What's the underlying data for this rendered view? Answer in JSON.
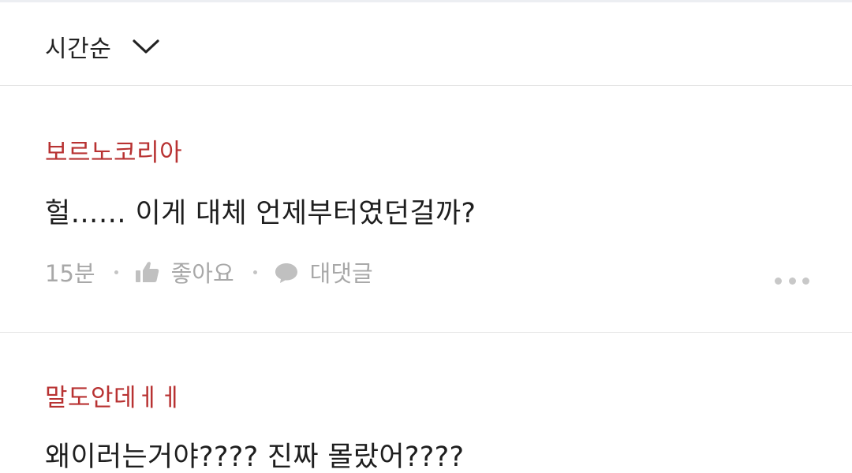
{
  "sort": {
    "label": "시간순",
    "icon": "chevron-down-icon"
  },
  "comments": [
    {
      "author": "보르노코리아",
      "text": "헐…… 이게 대체 언제부터였던걸까?",
      "time": "15분",
      "like_label": "좋아요",
      "reply_label": "대댓글",
      "like_icon": "thumbs-up-icon",
      "reply_icon": "speech-bubble-icon",
      "more_icon": "more-dots-icon"
    },
    {
      "author": "말도안데ㅔㅔ",
      "text": "왜이러는거야???? 진짜 몰랐어????"
    }
  ],
  "colors": {
    "author": "#b83232",
    "text": "#1e1e1e",
    "meta": "#a8a8a8",
    "divider": "#e4e4e4"
  }
}
